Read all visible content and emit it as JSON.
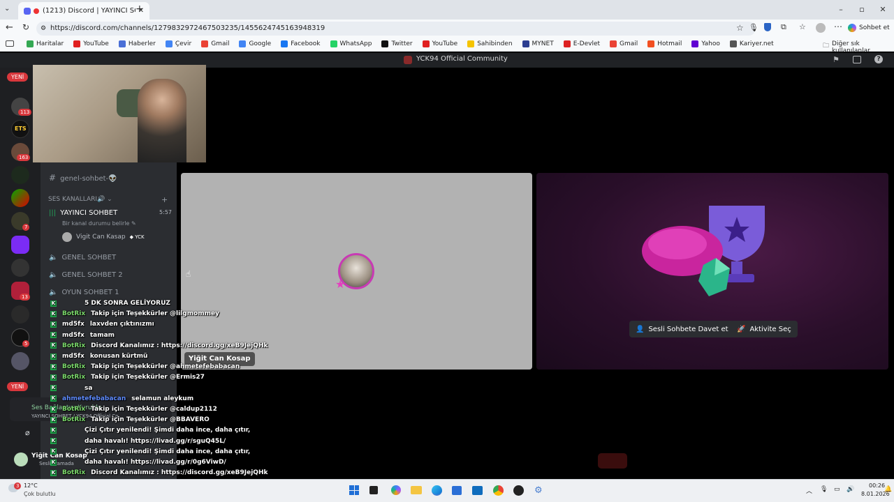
{
  "browser": {
    "tab_title": "(1213) Discord | YAYINCI SOHBET",
    "url": "https://discord.com/channels/1279832972467503235/1455624745163948319",
    "profile_button": "Sohbet et",
    "bookmarks": [
      {
        "label": "Haritalar",
        "color": "#34a853"
      },
      {
        "label": "YouTube",
        "color": "#e02020"
      },
      {
        "label": "Haberler",
        "color": "#4a6fd6"
      },
      {
        "label": "Çevir",
        "color": "#4285f4"
      },
      {
        "label": "Gmail",
        "color": "#ea4335"
      },
      {
        "label": "Google",
        "color": "#4285f4"
      },
      {
        "label": "Facebook",
        "color": "#1877f2"
      },
      {
        "label": "WhatsApp",
        "color": "#25d366"
      },
      {
        "label": "Twitter",
        "color": "#111111"
      },
      {
        "label": "YouTube",
        "color": "#e02020"
      },
      {
        "label": "Sahibinden",
        "color": "#f5c400"
      },
      {
        "label": "MYNET",
        "color": "#2c3e91"
      },
      {
        "label": "E-Devlet",
        "color": "#d22"
      },
      {
        "label": "Gmail",
        "color": "#ea4335"
      },
      {
        "label": "Hotmail",
        "color": "#f25022"
      },
      {
        "label": "Yahoo",
        "color": "#6001d2"
      },
      {
        "label": "Kariyer.net",
        "color": "#555"
      }
    ],
    "other_bookmarks": "Diğer sık kullanılanlar"
  },
  "discord": {
    "server_title": "YCK94 Official Community",
    "new_badge": "YENİ",
    "rail_badges": [
      "113",
      "163",
      "7",
      "13",
      "5"
    ],
    "channels": {
      "text_channel": "genel-sohbet-👽",
      "voice_category": "SES KANALLARI🔊",
      "active_voice": "YAYINCI SOHBET",
      "active_time": "5:57",
      "status_hint": "Bir kanal durumu belirle",
      "member_name": "Vigit Can Kasap",
      "member_tag": "YCK",
      "voice_list": [
        "GENEL SOHBET",
        "GENEL SOHBET 2",
        "OYUN SOHBET 1"
      ]
    },
    "stage": {
      "user_label": "Yiğit Can Kosap",
      "invite_button": "Sesli Sohbete Davet et",
      "activity_button": "Aktivite Seç"
    },
    "user_panel": {
      "name": "Yiğit Can Kosap",
      "status": "Sesli aramada",
      "voice_status": "Ses Bağlantısı Kuruldu",
      "voice_sub": "YAYINCI SOHBET / YCK94 Official Co..."
    }
  },
  "chat": [
    {
      "user": "",
      "msg": "5 DK SONRA GELİYORUZ"
    },
    {
      "user": "BotRix",
      "msg": "Takip için Teşekkürler @lilgmommey"
    },
    {
      "user": "md5fx",
      "msg": "laxvden çıktınızmı"
    },
    {
      "user": "md5fx",
      "msg": "tamam"
    },
    {
      "user": "BotRix",
      "msg": "Discord Kanalımız : https://discord.gg/xeB9JejQHk"
    },
    {
      "user": "md5fx",
      "msg": "konusan kürtmü"
    },
    {
      "user": "BotRix",
      "msg": "Takip için Teşekkürler @ahmetefebabacan"
    },
    {
      "user": "BotRix",
      "msg": "Takip için Teşekkürler @Ermis27"
    },
    {
      "user": "",
      "msg": "sa"
    },
    {
      "user": "ahmetefebabacan",
      "msg": "selamun aleykum"
    },
    {
      "user": "BotRix",
      "msg": "Takip için Teşekkürler @caldup2112"
    },
    {
      "user": "BotRix",
      "msg": "Takip için Teşekkürler @BBAVERO"
    },
    {
      "user": "",
      "msg": "Çizi Çıtır yenilendi! Şimdi daha ince, daha çıtır,"
    },
    {
      "user": "",
      "msg": "daha havalı! https://livad.gg/r/sguQ45L/"
    },
    {
      "user": "",
      "msg": "Çizi Çıtır yenilendi! Şimdi daha ince, daha çıtır,"
    },
    {
      "user": "",
      "msg": "daha havalı! https://livad.gg/r/0g6ViwD/"
    },
    {
      "user": "BotRix",
      "msg": "Discord Kanalımız : https://discord.gg/xeB9JejQHk"
    }
  ],
  "taskbar": {
    "weather_temp": "12°C",
    "weather_desc": "Çok bulutlu",
    "time": "00:26",
    "date": "8.01.2026"
  }
}
